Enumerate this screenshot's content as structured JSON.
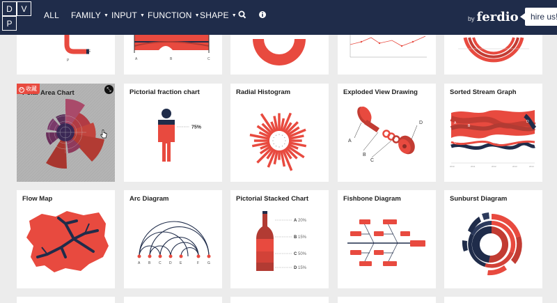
{
  "header": {
    "logo_letters": [
      "D",
      "V",
      "P"
    ],
    "nav": [
      {
        "label": "ALL"
      },
      {
        "label": "FAMILY"
      },
      {
        "label": "INPUT"
      },
      {
        "label": "FUNCTION"
      },
      {
        "label": "SHAPE"
      }
    ],
    "by_label": "by",
    "brand": "ferdio",
    "hire_label": "hire us!"
  },
  "colors": {
    "navy": "#1f2c4a",
    "accent_red": "#e84a3f",
    "dark_red": "#a8362f",
    "card_bg": "#ffffff",
    "page_bg": "#ececec"
  },
  "cards": [
    {
      "title": "Polar Area Chart",
      "tag": "收藏",
      "hovered": true
    },
    {
      "title": "Pictorial fraction chart",
      "value_label": "75%"
    },
    {
      "title": "Radial Histogram"
    },
    {
      "title": "Exploded View Drawing",
      "labels": [
        "A",
        "B",
        "C",
        "D"
      ]
    },
    {
      "title": "Sorted Stream Graph",
      "labels": [
        "A",
        "B",
        "C",
        "D"
      ]
    },
    {
      "title": "Flow Map"
    },
    {
      "title": "Arc Diagram",
      "nodes": [
        "A",
        "B",
        "C",
        "D",
        "E",
        "F",
        "G"
      ]
    },
    {
      "title": "Pictorial Stacked Chart",
      "segments": [
        {
          "letter": "A",
          "value": "20%"
        },
        {
          "letter": "B",
          "value": "15%"
        },
        {
          "letter": "C",
          "value": "50%"
        },
        {
          "letter": "D",
          "value": "15%"
        }
      ]
    },
    {
      "title": "Fishbone Diagram"
    },
    {
      "title": "Sunburst Diagram"
    }
  ],
  "top_partial_labels": {
    "col1": [
      "P",
      "E"
    ],
    "col2": [
      "A",
      "B",
      "C"
    ]
  }
}
